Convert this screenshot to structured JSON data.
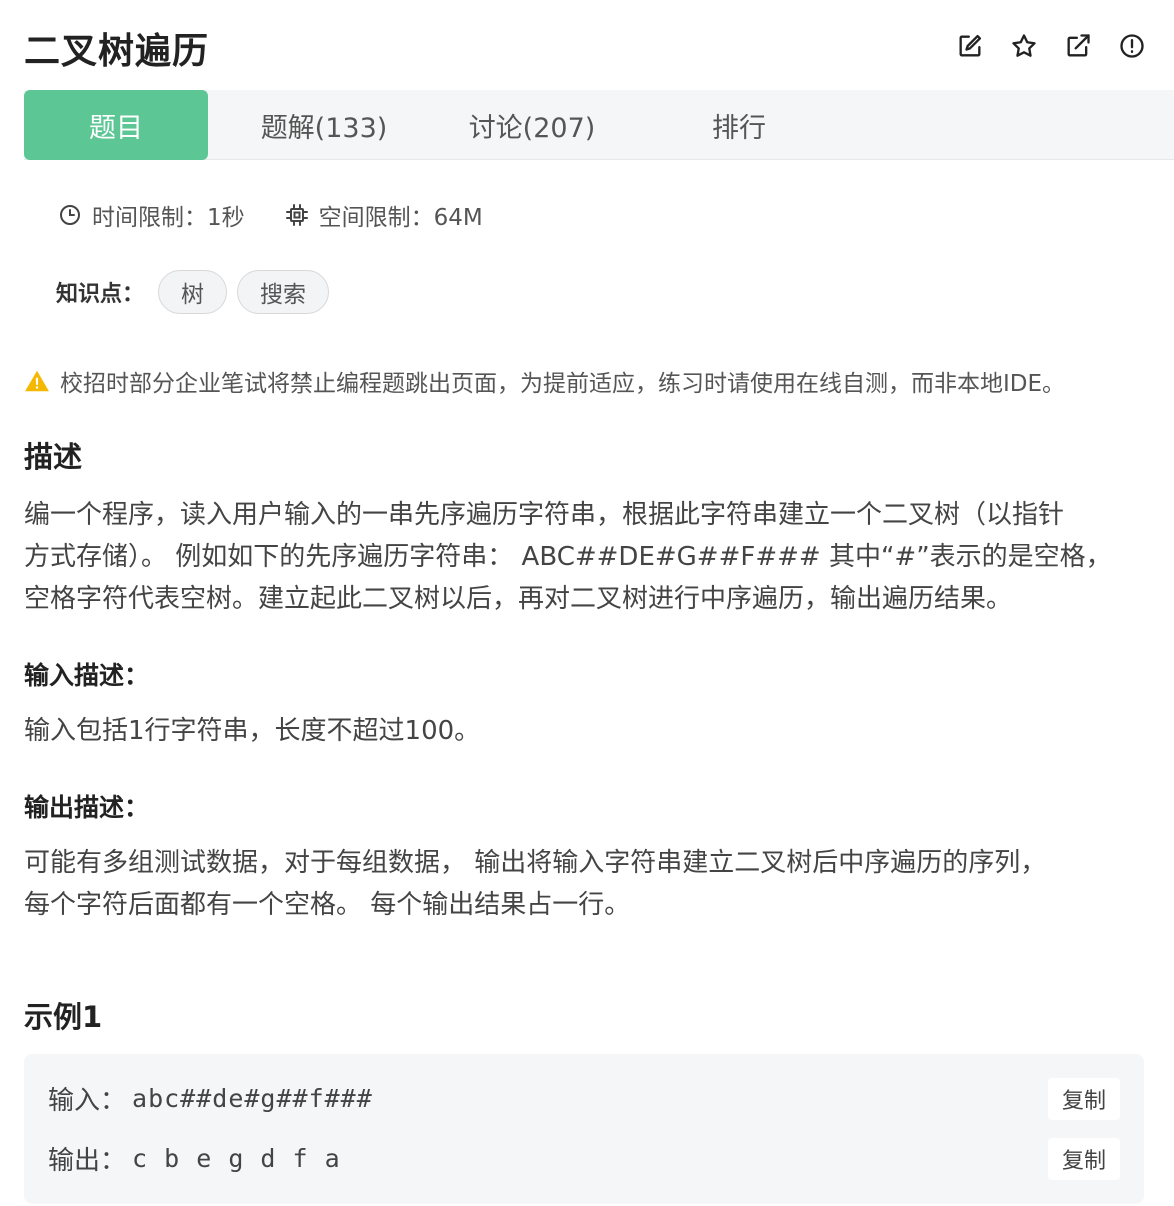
{
  "header": {
    "title": "二叉树遍历",
    "tools": [
      "edit-icon",
      "star-icon",
      "external-link-icon",
      "report-icon"
    ]
  },
  "tabs": [
    {
      "label": "题目"
    },
    {
      "label": "题解(133)"
    },
    {
      "label": "讨论(207)"
    },
    {
      "label": "排行"
    }
  ],
  "limits": {
    "time": "时间限制：1秒",
    "space": "空间限制：64M"
  },
  "knowledge": {
    "label": "知识点：",
    "tags": [
      "树",
      "搜索"
    ]
  },
  "warning": "校招时部分企业笔试将禁止编程题跳出页面，为提前适应，练习时请使用在线自测，而非本地IDE。",
  "description": {
    "heading": "描述",
    "lines": [
      "编一个程序，读入用户输入的一串先序遍历字符串，根据此字符串建立一个二叉树（以指针",
      "方式存储）。 例如如下的先序遍历字符串： ABC##DE#G##F### 其中“#”表示的是空格，",
      "空格字符代表空树。建立起此二叉树以后，再对二叉树进行中序遍历，输出遍历结果。"
    ]
  },
  "input_desc": {
    "heading": "输入描述：",
    "text": "输入包括1行字符串，长度不超过100。"
  },
  "output_desc": {
    "heading": "输出描述：",
    "lines": [
      "可能有多组测试数据，对于每组数据， 输出将输入字符串建立二叉树后中序遍历的序列，",
      "每个字符后面都有一个空格。 每个输出结果占一行。"
    ]
  },
  "example": {
    "heading": "示例1",
    "input_label": "输入：",
    "input_value": "abc##de#g##f###",
    "output_label": "输出：",
    "output_value": "c b e g d f a",
    "copy_label": "复制"
  },
  "colors": {
    "accent": "#5cc794",
    "warning": "#f5b800"
  }
}
